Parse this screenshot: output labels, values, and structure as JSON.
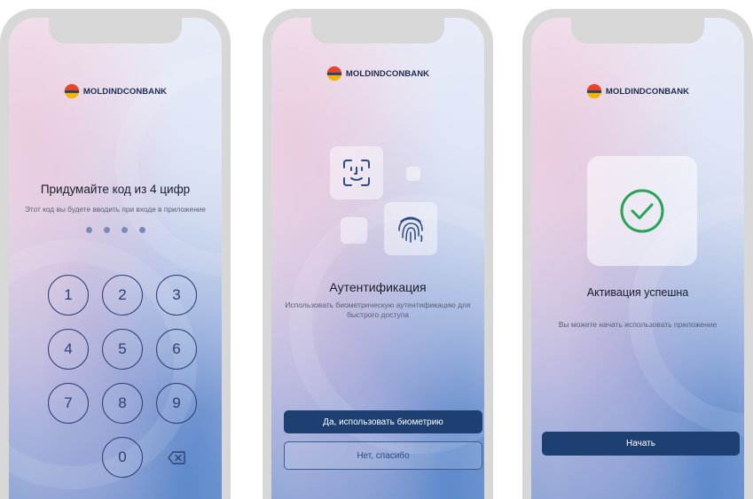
{
  "brand": {
    "name": "MOLDINDCONBANK"
  },
  "colors": {
    "primary": "#1d3f72",
    "success": "#27a557",
    "key_outline": "#2e3f73"
  },
  "screen1": {
    "title": "Придумайте код из 4 цифр",
    "subtitle": "Этот код вы будете вводить при входе в приложение",
    "keys": [
      "1",
      "2",
      "3",
      "4",
      "5",
      "6",
      "7",
      "8",
      "9",
      "0"
    ],
    "backspace_icon": "backspace-icon"
  },
  "screen2": {
    "icons": [
      "face-id-icon",
      "fingerprint-icon"
    ],
    "title": "Аутентификация",
    "subtitle": "Использовать биометрическую аутентификацию для быстрого доступа",
    "primary_button": "Да, использовать биометрию",
    "secondary_button": "Нет, спасибо"
  },
  "screen3": {
    "icon": "check-circle-icon",
    "title": "Активация успешна",
    "subtitle": "Вы можете начать использовать приложение",
    "primary_button": "Начать"
  }
}
